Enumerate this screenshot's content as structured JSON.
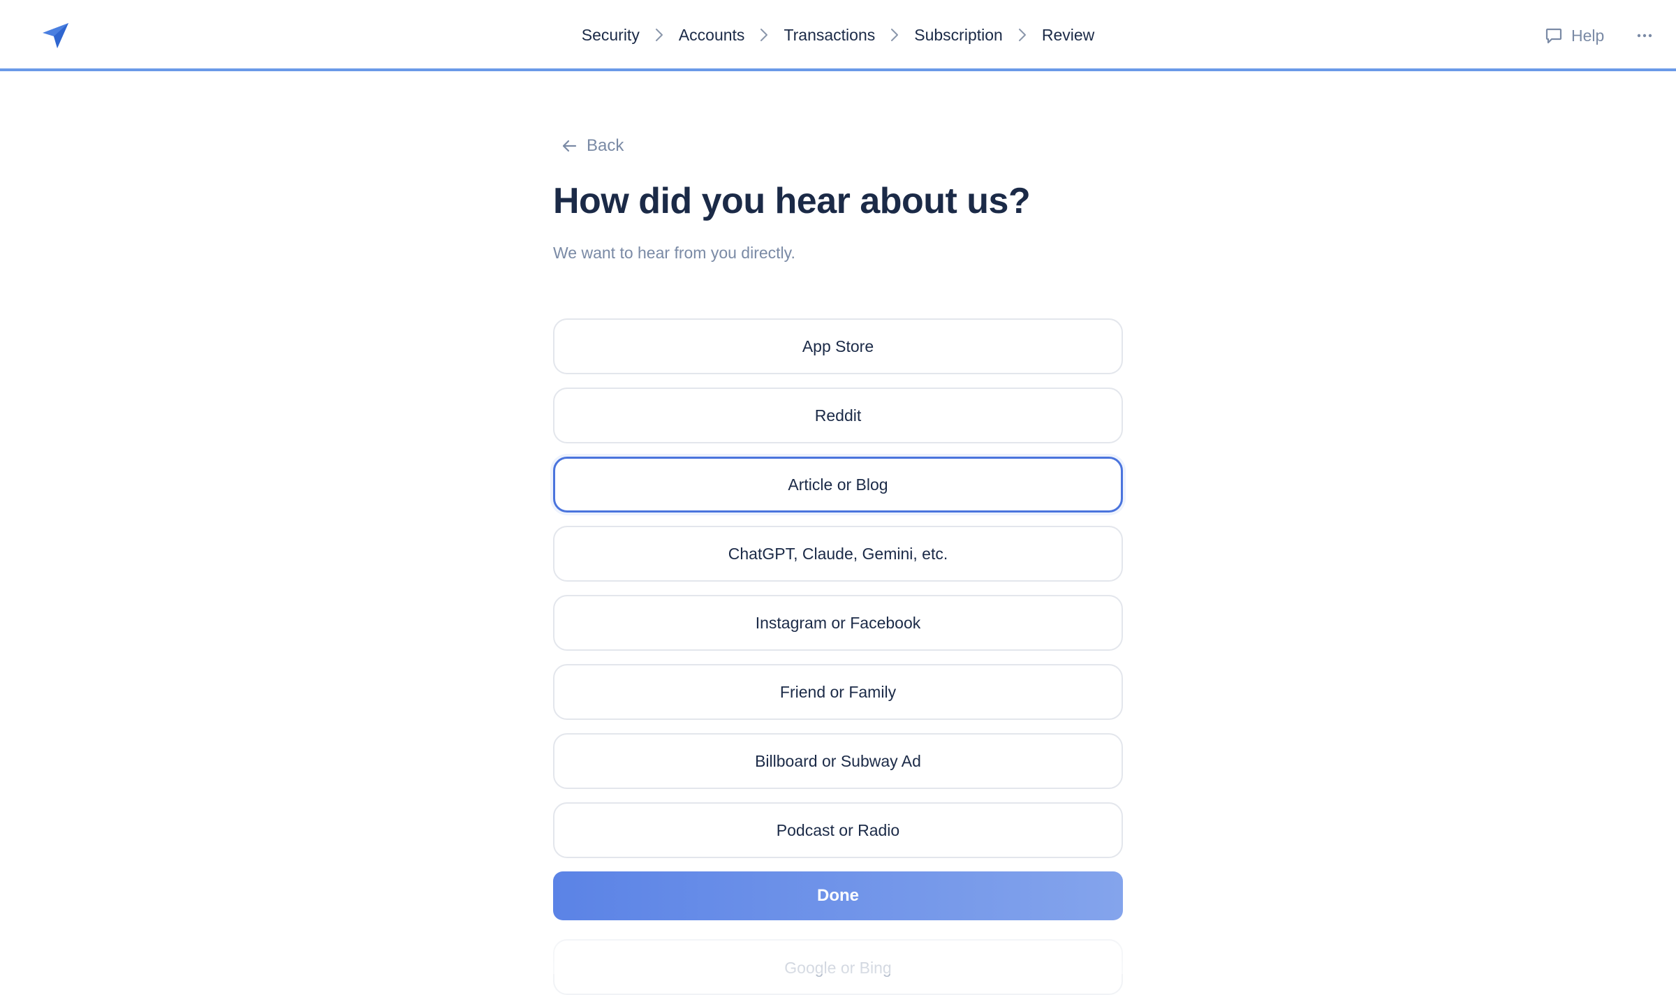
{
  "header": {
    "logo_icon": "paper-plane-icon",
    "breadcrumb": [
      {
        "label": "Security"
      },
      {
        "label": "Accounts"
      },
      {
        "label": "Transactions"
      },
      {
        "label": "Subscription"
      },
      {
        "label": "Review"
      }
    ],
    "help_label": "Help",
    "help_icon": "chat-bubble-icon",
    "more_icon": "more-horizontal-icon"
  },
  "main": {
    "back_label": "Back",
    "back_icon": "arrow-left-icon",
    "title": "How did you hear about us?",
    "subtitle": "We want to hear from you directly.",
    "options": [
      {
        "label": "App Store"
      },
      {
        "label": "Reddit"
      },
      {
        "label": "Article or Blog",
        "selected": true
      },
      {
        "label": "ChatGPT, Claude, Gemini, etc."
      },
      {
        "label": "Instagram or Facebook"
      },
      {
        "label": "Friend or Family"
      },
      {
        "label": "Billboard or Subway Ad"
      },
      {
        "label": "Podcast or Radio"
      }
    ],
    "done_label": "Done",
    "next_option_label": "Google or Bing"
  },
  "colors": {
    "accent": "#4a74dd",
    "done_gradient_start": "#5b83e6",
    "done_gradient_end": "#84a4ec",
    "header_border": "#6a9ae8",
    "text_primary": "#1b2a47",
    "text_muted": "#7a8aa5"
  }
}
